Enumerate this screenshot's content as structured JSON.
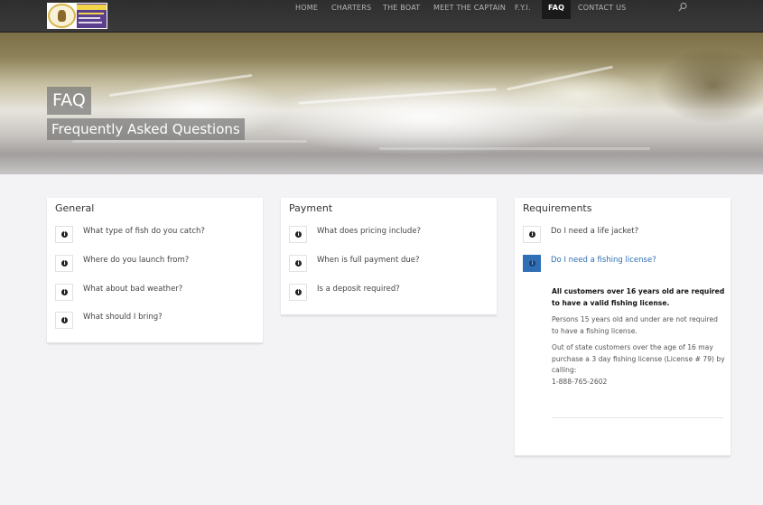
{
  "nav": {
    "items": [
      {
        "label": "HOME",
        "active": false
      },
      {
        "label": "CHARTERS",
        "active": false
      },
      {
        "label": "THE BOAT",
        "active": false
      },
      {
        "label": "MEET THE CAPTAIN",
        "active": false
      },
      {
        "label": "F.Y.I.",
        "active": false
      },
      {
        "label": "FAQ",
        "active": true
      },
      {
        "label": "CONTACT US",
        "active": false
      }
    ],
    "search_icon": "search-icon"
  },
  "hero": {
    "title": "FAQ",
    "subtitle": "Frequently Asked Questions"
  },
  "sections": [
    {
      "heading": "General",
      "questions": [
        "What type of fish do you catch?",
        "Where do you launch from?",
        "What about bad weather?",
        "What should I bring?"
      ]
    },
    {
      "heading": "Payment",
      "questions": [
        "What does pricing include?",
        "When is full payment due?",
        "Is a deposit required?"
      ]
    },
    {
      "heading": "Requirements",
      "questions": [
        "Do I need a life jacket?",
        "Do I need a fishing license?"
      ],
      "open_question": "Do I need a fishing license?",
      "answer": {
        "strong": "All customers over 16 years old are required to have a valid fishing license.",
        "p1": "Persons 15 years old and under are not required to have a fishing license.",
        "p2": "Out of state customers over the age of 16 may purchase a 3 day fishing license (License # 79) by calling:",
        "phone": "1-888-765-2602"
      }
    }
  ],
  "colors": {
    "accent": "#2f6fb5",
    "nav_bg": "#333333",
    "page_bg": "#f3f3f5"
  }
}
